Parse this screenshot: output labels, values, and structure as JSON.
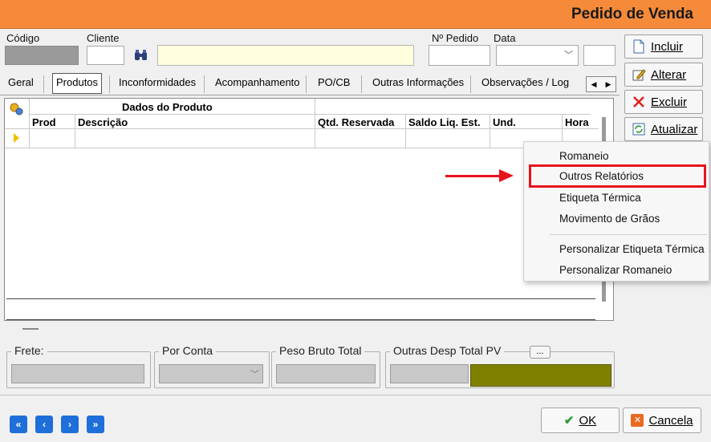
{
  "window": {
    "title": "Pedido de Venda"
  },
  "header": {
    "codigo_label": "Código",
    "cliente_label": "Cliente",
    "num_pedido_label": "Nº Pedido",
    "data_label": "Data"
  },
  "tabs": [
    {
      "label": "Geral"
    },
    {
      "label": "Produtos"
    },
    {
      "label": "Inconformidades"
    },
    {
      "label": "Acompanhamento"
    },
    {
      "label": "PO/CB"
    },
    {
      "label": "Outras Informações"
    },
    {
      "label": "Observações / Log"
    }
  ],
  "grid": {
    "group_header": "Dados do Produto",
    "columns": [
      "Prod",
      "Descrição",
      "Qtd. Reservada",
      "Saldo Liq. Est.",
      "Und.",
      "Hora"
    ]
  },
  "sidebar": {
    "incluir": "Incluir",
    "alterar": "Alterar",
    "excluir": "Excluir",
    "atualizar": "Atualizar"
  },
  "context_menu": {
    "items": [
      "Romaneio",
      "Outros Relatórios",
      "Etiqueta Térmica",
      "Movimento de Grãos",
      "Personalizar Etiqueta Térmica",
      "Personalizar Romaneio"
    ],
    "highlighted": "Outros Relatórios"
  },
  "footer_fields": {
    "frete": "Frete:",
    "por_conta": "Por Conta",
    "peso_bruto": "Peso Bruto Total",
    "outras_desp": "Outras Desp Total PV",
    "outras_desp_button": "..."
  },
  "buttons": {
    "ok": "OK",
    "cancelar": "Cancela"
  },
  "colors": {
    "title_bar": "#f58a3a",
    "highlight": "#e8141c",
    "total_box": "#808000",
    "nav": "#1e6fd9"
  },
  "icons": [
    "binoculars-icon",
    "document-icon",
    "pencil-icon",
    "x-icon",
    "refresh-icon",
    "checkmark-icon",
    "cancel-icon"
  ]
}
